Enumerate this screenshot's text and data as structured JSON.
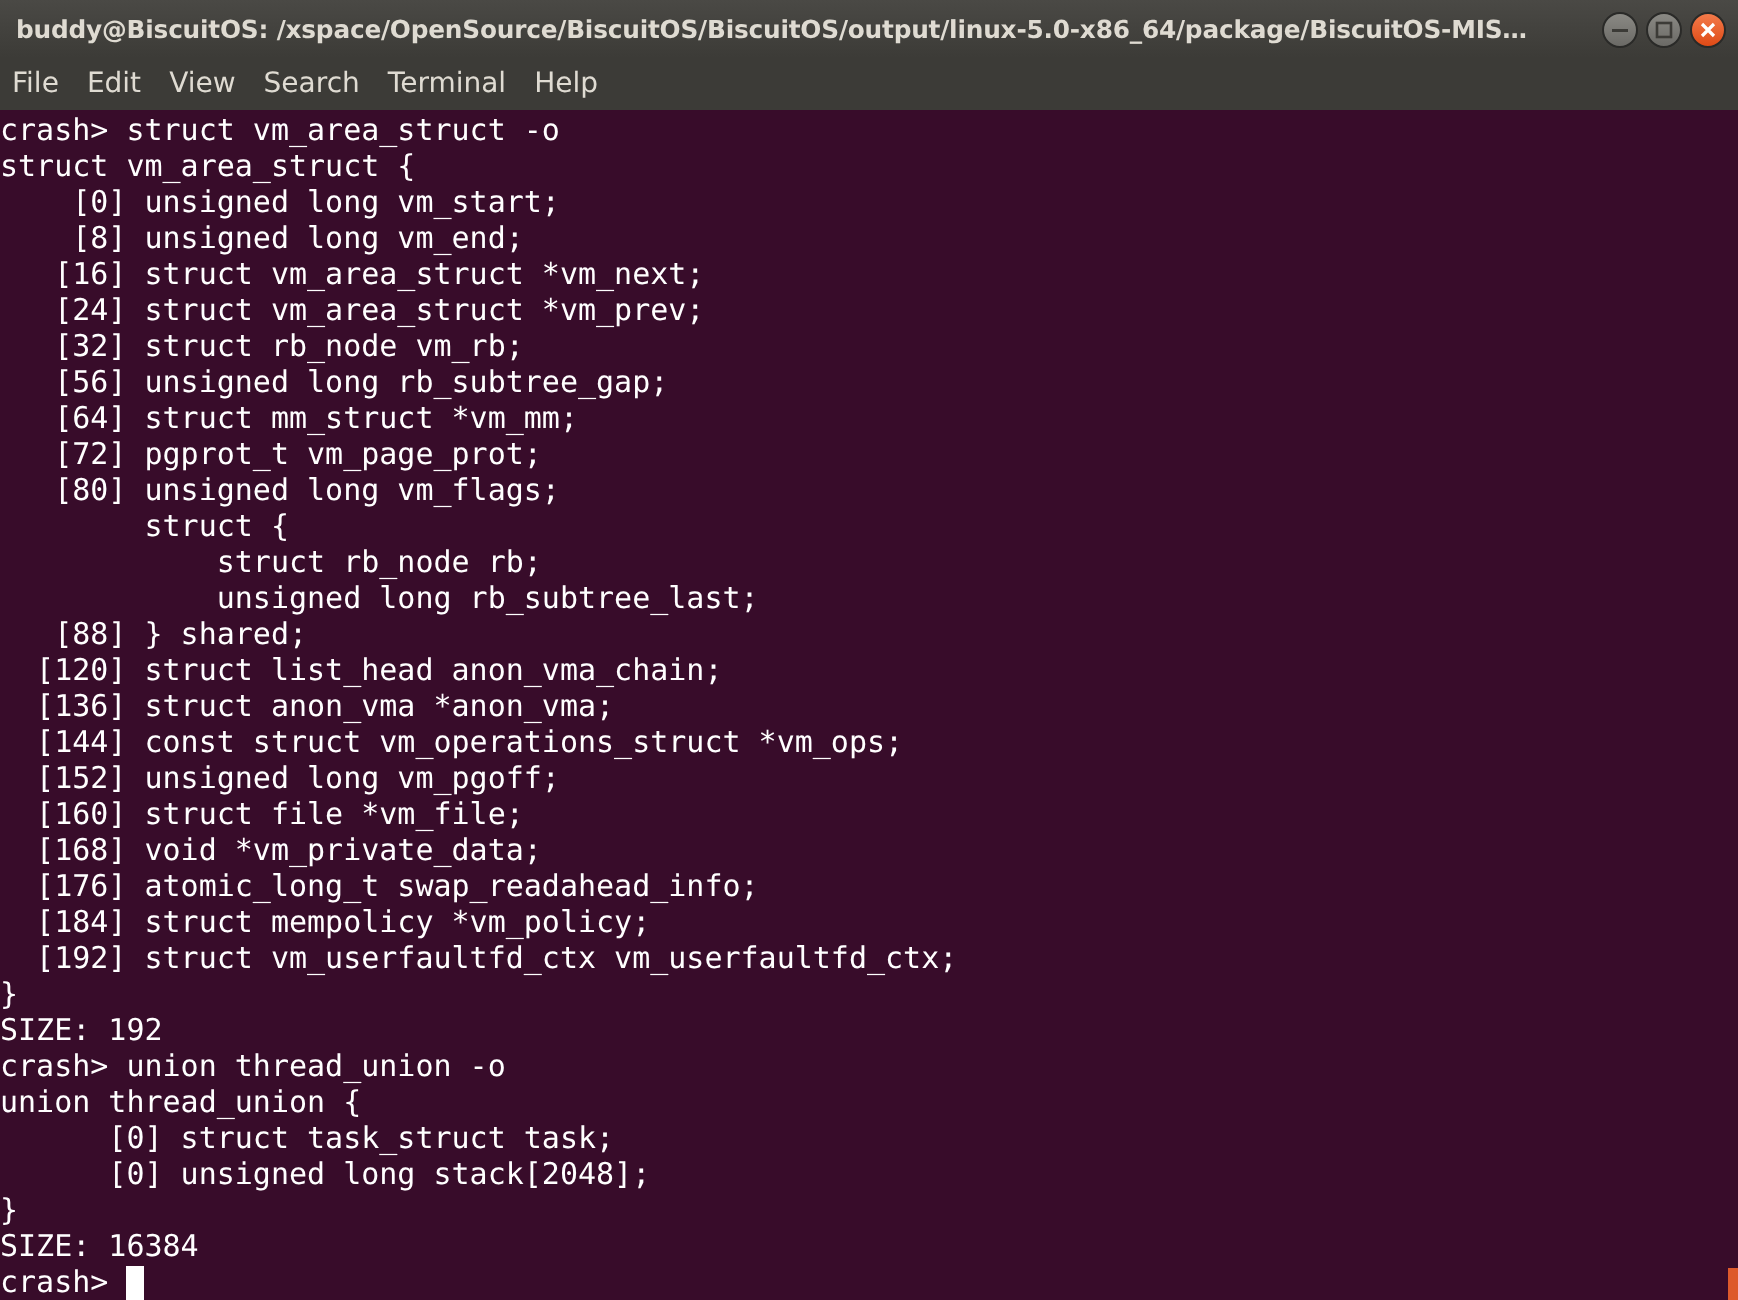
{
  "window": {
    "title": "buddy@BiscuitOS: /xspace/OpenSource/BiscuitOS/BiscuitOS/output/linux-5.0-x86_64/package/BiscuitOS-MIS…"
  },
  "menu": [
    "File",
    "Edit",
    "View",
    "Search",
    "Terminal",
    "Help"
  ],
  "terminal": {
    "lines": [
      "crash> struct vm_area_struct -o",
      "struct vm_area_struct {",
      "    [0] unsigned long vm_start;",
      "    [8] unsigned long vm_end;",
      "   [16] struct vm_area_struct *vm_next;",
      "   [24] struct vm_area_struct *vm_prev;",
      "   [32] struct rb_node vm_rb;",
      "   [56] unsigned long rb_subtree_gap;",
      "   [64] struct mm_struct *vm_mm;",
      "   [72] pgprot_t vm_page_prot;",
      "   [80] unsigned long vm_flags;",
      "        struct {",
      "            struct rb_node rb;",
      "            unsigned long rb_subtree_last;",
      "   [88] } shared;",
      "  [120] struct list_head anon_vma_chain;",
      "  [136] struct anon_vma *anon_vma;",
      "  [144] const struct vm_operations_struct *vm_ops;",
      "  [152] unsigned long vm_pgoff;",
      "  [160] struct file *vm_file;",
      "  [168] void *vm_private_data;",
      "  [176] atomic_long_t swap_readahead_info;",
      "  [184] struct mempolicy *vm_policy;",
      "  [192] struct vm_userfaultfd_ctx vm_userfaultfd_ctx;",
      "}",
      "SIZE: 192",
      "crash> union thread_union -o",
      "union thread_union {",
      "      [0] struct task_struct task;",
      "      [0] unsigned long stack[2048];",
      "}",
      "SIZE: 16384"
    ],
    "prompt": "crash>"
  }
}
